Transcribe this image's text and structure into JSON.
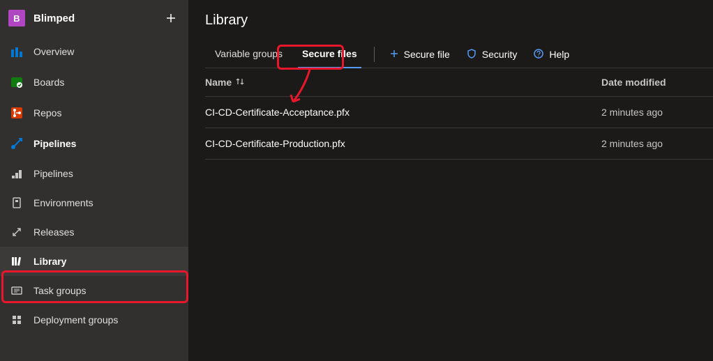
{
  "project": {
    "badge": "B",
    "name": "Blimped"
  },
  "nav": [
    {
      "id": "overview",
      "label": "Overview"
    },
    {
      "id": "boards",
      "label": "Boards"
    },
    {
      "id": "repos",
      "label": "Repos"
    },
    {
      "id": "pipelines",
      "label": "Pipelines"
    }
  ],
  "sub": [
    {
      "id": "pipelines-sub",
      "label": "Pipelines"
    },
    {
      "id": "environments",
      "label": "Environments"
    },
    {
      "id": "releases",
      "label": "Releases"
    },
    {
      "id": "library",
      "label": "Library"
    },
    {
      "id": "task-groups",
      "label": "Task groups"
    },
    {
      "id": "deployment-groups",
      "label": "Deployment groups"
    }
  ],
  "page": {
    "title": "Library"
  },
  "tabs": {
    "variable_groups": "Variable groups",
    "secure_files": "Secure files"
  },
  "actions": {
    "secure_file": "Secure file",
    "security": "Security",
    "help": "Help"
  },
  "table": {
    "col_name": "Name",
    "col_date": "Date modified",
    "rows": [
      {
        "name": "CI-CD-Certificate-Acceptance.pfx",
        "date": "2 minutes ago"
      },
      {
        "name": "CI-CD-Certificate-Production.pfx",
        "date": "2 minutes ago"
      }
    ]
  }
}
